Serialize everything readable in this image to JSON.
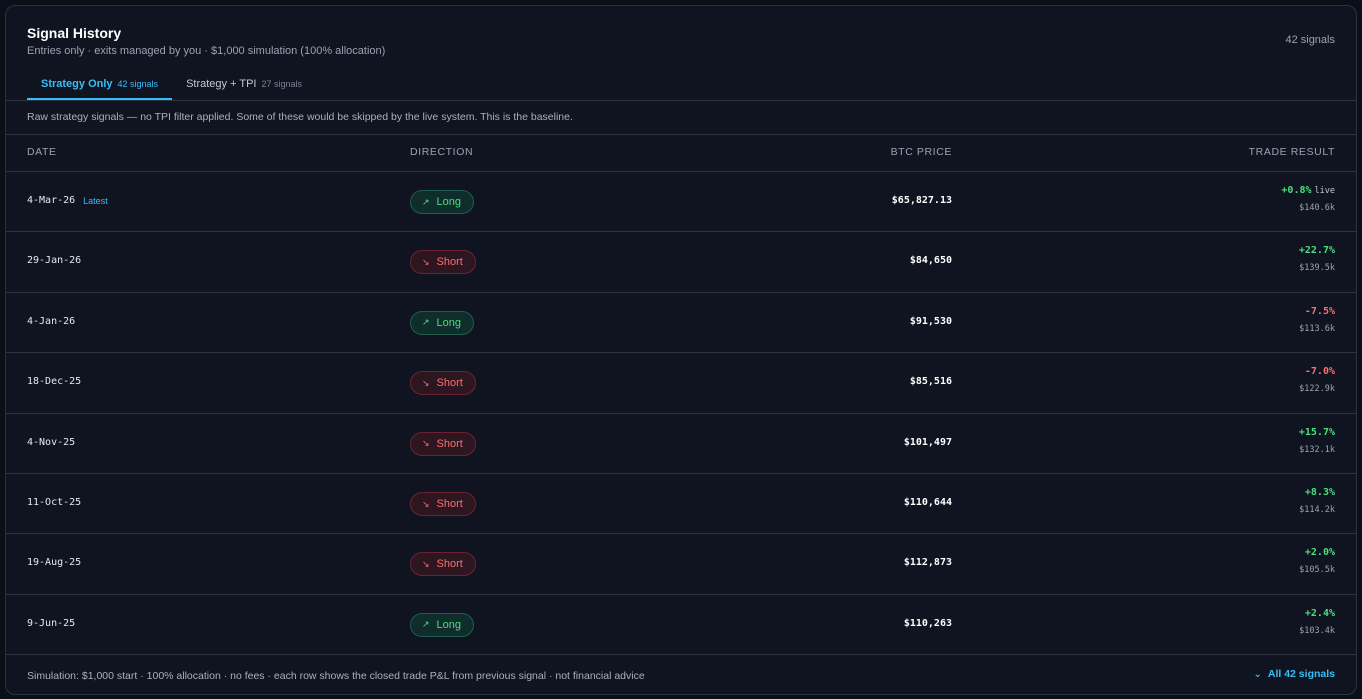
{
  "header": {
    "title": "Signal History",
    "subtitle": "Entries only · exits managed by you · $1,000 simulation (100% allocation)",
    "total_count": "42 signals"
  },
  "tabs": [
    {
      "label": "Strategy Only",
      "count": "42 signals",
      "active": true
    },
    {
      "label": "Strategy + TPI",
      "count": "27 signals",
      "active": false
    }
  ],
  "note": "Raw strategy signals — no TPI filter applied. Some of these would be skipped by the live system. This is the baseline.",
  "columns": [
    "DATE",
    "DIRECTION",
    "BTC PRICE",
    "TRADE RESULT"
  ],
  "latest_label": "Latest",
  "live_label": "live",
  "icons": {
    "long": "arrow-up-right-icon",
    "short": "arrow-down-right-icon",
    "expand": "chevron-down-icon"
  },
  "rows": [
    {
      "date": "4-Mar-26",
      "direction": "Long",
      "price": "$65,827.13",
      "result": "+0.8%",
      "value": "$140.6k"
    },
    {
      "date": "29-Jan-26",
      "direction": "Short",
      "price": "$84,650",
      "result": "+22.7%",
      "value": "$139.5k"
    },
    {
      "date": "4-Jan-26",
      "direction": "Long",
      "price": "$91,530",
      "result": "-7.5%",
      "value": "$113.6k"
    },
    {
      "date": "18-Dec-25",
      "direction": "Short",
      "price": "$85,516",
      "result": "-7.0%",
      "value": "$122.9k"
    },
    {
      "date": "4-Nov-25",
      "direction": "Short",
      "price": "$101,497",
      "result": "+15.7%",
      "value": "$132.1k"
    },
    {
      "date": "11-Oct-25",
      "direction": "Short",
      "price": "$110,644",
      "result": "+8.3%",
      "value": "$114.2k"
    },
    {
      "date": "19-Aug-25",
      "direction": "Short",
      "price": "$112,873",
      "result": "+2.0%",
      "value": "$105.5k"
    },
    {
      "date": "9-Jun-25",
      "direction": "Long",
      "price": "$110,263",
      "result": "+2.4%",
      "value": "$103.4k"
    }
  ],
  "footer": {
    "text": "Simulation: $1,000 start · 100% allocation · no fees · each row shows the closed trade P&L from previous signal · not financial advice",
    "all_label": "All 42 signals"
  },
  "colors": {
    "accent": "#38bdf8",
    "positive": "#4ade80",
    "negative": "#f87171",
    "panel": "#0f1420"
  }
}
